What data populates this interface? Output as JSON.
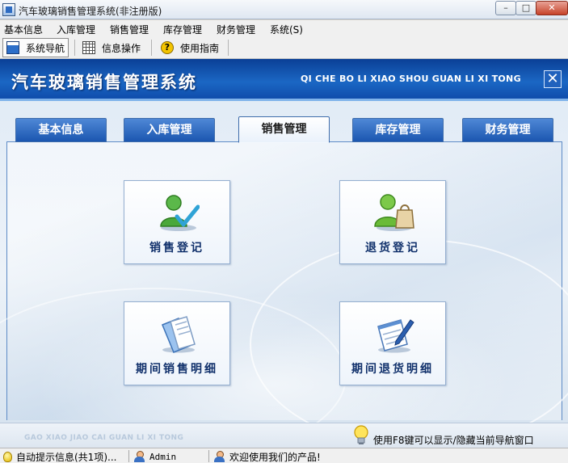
{
  "window": {
    "title": "汽车玻璃销售管理系统(非注册版)",
    "min": "–",
    "max": "□",
    "close": "✕"
  },
  "menu": [
    "基本信息",
    "入库管理",
    "销售管理",
    "库存管理",
    "财务管理",
    "系统(S)"
  ],
  "toolbar": {
    "nav": "系统导航",
    "info": "信息操作",
    "help": "使用指南"
  },
  "banner": {
    "title": "汽车玻璃销售管理系统",
    "pinyin": "QI CHE BO LI XIAO SHOU GUAN LI XI TONG",
    "close": "✕"
  },
  "tabs": [
    "基本信息",
    "入库管理",
    "销售管理",
    "库存管理",
    "财务管理"
  ],
  "active_tab": "销售管理",
  "functions": [
    {
      "label": "销售登记",
      "icon": "user-check-icon"
    },
    {
      "label": "退货登记",
      "icon": "user-bag-icon"
    },
    {
      "label": "期间销售明细",
      "icon": "documents-icon"
    },
    {
      "label": "期间退货明细",
      "icon": "notepad-pen-icon"
    }
  ],
  "footer": {
    "pinyin": "GAO XIAO JIAO CAI GUAN LI XI TONG",
    "tip": "使用F8键可以显示/隐藏当前导航窗口"
  },
  "status": {
    "notice": "自动提示信息(共1项)...",
    "user": "Admin",
    "welcome": "欢迎使用我们的产品!"
  },
  "colors": {
    "banner": "#1b67c4",
    "tab": "#1b56b0",
    "label": "#10306b"
  }
}
